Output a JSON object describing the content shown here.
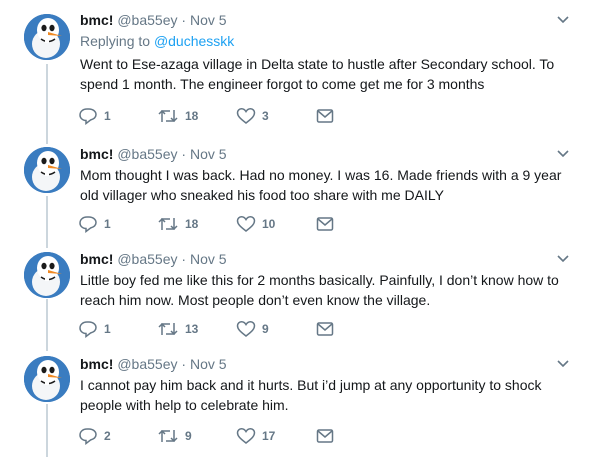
{
  "tweets": [
    {
      "name": "bmc!",
      "handle": "@ba55ey",
      "sep": "·",
      "date": "Nov 5",
      "replying_label": "Replying to",
      "replying_to": "@duchesskk",
      "text": "Went to Ese-azaga village in Delta state to hustle after Secondary school. To spend 1 month. The engineer forgot to come get me for 3 months",
      "replies": "1",
      "retweets": "18",
      "likes": "3"
    },
    {
      "name": "bmc!",
      "handle": "@ba55ey",
      "sep": "·",
      "date": "Nov 5",
      "text": "Mom thought I was back. Had no money. I was 16. Made friends with a 9 year old villager who sneaked his food too share with me DAILY",
      "replies": "1",
      "retweets": "18",
      "likes": "10"
    },
    {
      "name": "bmc!",
      "handle": "@ba55ey",
      "sep": "·",
      "date": "Nov 5",
      "text": "Little boy fed me like this for 2 months basically. Painfully, I don’t know how to reach him now. Most people don’t even know the village.",
      "replies": "1",
      "retweets": "13",
      "likes": "9"
    },
    {
      "name": "bmc!",
      "handle": "@ba55ey",
      "sep": "·",
      "date": "Nov 5",
      "text": "I cannot pay him back and it hurts. But i’d jump at any opportunity to shock people with help to celebrate him.",
      "replies": "2",
      "retweets": "9",
      "likes": "17"
    }
  ],
  "icons": [
    "snowman-avatar-icon",
    "chevron-down-icon",
    "reply-icon",
    "retweet-icon",
    "like-icon",
    "direct-message-icon"
  ],
  "colors": {
    "link": "#1da1f2",
    "meta": "#657786",
    "thread_line": "#ccd6dd",
    "text": "#14171a"
  }
}
